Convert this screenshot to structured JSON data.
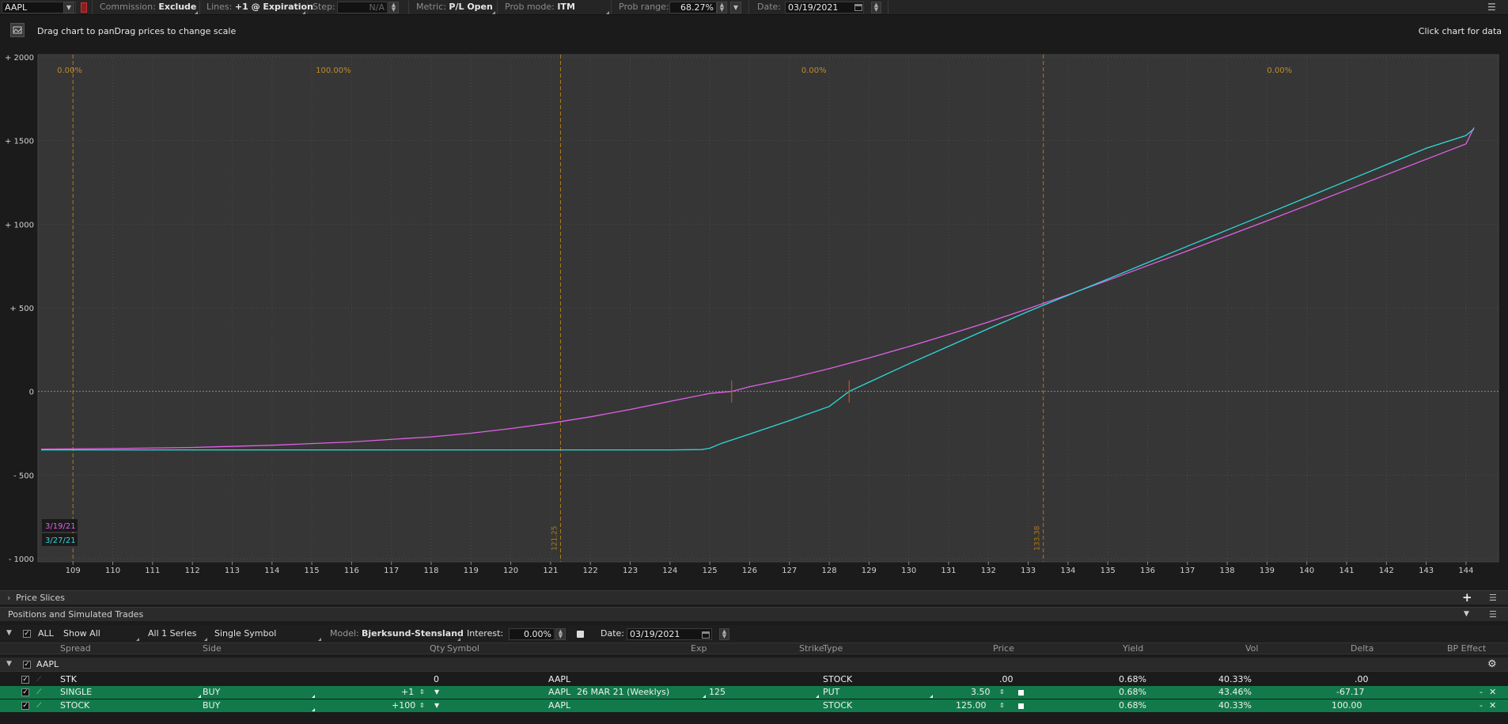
{
  "toolbar": {
    "symbol": "AAPL",
    "commission_label": "Commission:",
    "commission_value": "Exclude",
    "lines_label": "Lines:",
    "lines_value": "+1 @ Expiration",
    "step_label": "Step:",
    "step_value": "N/A",
    "metric_label": "Metric:",
    "metric_value": "P/L Open",
    "probmode_label": "Prob mode:",
    "probmode_value": "ITM",
    "probrange_label": "Prob range:",
    "probrange_value": "68.27%",
    "date_label": "Date:",
    "date_value": "03/19/2021"
  },
  "info": {
    "drag_hint": "Drag chart to panDrag prices to change scale",
    "click_hint": "Click chart for data"
  },
  "chart_data": {
    "type": "line",
    "x_ticks": [
      109,
      110,
      111,
      112,
      113,
      114,
      115,
      116,
      117,
      118,
      119,
      120,
      121,
      122,
      123,
      124,
      125,
      126,
      127,
      128,
      129,
      130,
      131,
      132,
      133,
      134,
      135,
      136,
      137,
      138,
      139,
      140,
      141,
      142,
      143,
      144
    ],
    "y_ticks": [
      {
        "value": 2000,
        "label": "+ 2000"
      },
      {
        "value": 1500,
        "label": "+ 1500"
      },
      {
        "value": 1000,
        "label": "+ 1000"
      },
      {
        "value": 500,
        "label": "+ 500"
      },
      {
        "value": 0,
        "label": "0"
      },
      {
        "value": -500,
        "label": "- 500"
      },
      {
        "value": -1000,
        "label": "- 1000"
      }
    ],
    "xlim": [
      108.1,
      144.5
    ],
    "ylim": [
      -1000,
      2000
    ],
    "prob_lines": [
      {
        "x": 109,
        "label": ""
      },
      {
        "x": 121.25,
        "label": "121.25"
      },
      {
        "x": 133.38,
        "label": "133.38"
      }
    ],
    "prob_zones": [
      {
        "x": 108.6,
        "text": "0.00%"
      },
      {
        "x": 115.1,
        "text": "100.00%"
      },
      {
        "x": 127.3,
        "text": "0.00%"
      },
      {
        "x": 139.0,
        "text": "0.00%"
      }
    ],
    "breakeven_marks": [
      {
        "x": 125.55,
        "y": 0
      },
      {
        "x": 128.5,
        "y": 0
      }
    ],
    "series": [
      {
        "name": "3/19/21",
        "color": "#e060e8",
        "points": [
          [
            108.2,
            -345
          ],
          [
            110,
            -342
          ],
          [
            112,
            -335
          ],
          [
            114,
            -322
          ],
          [
            116,
            -302
          ],
          [
            118,
            -272
          ],
          [
            119,
            -250
          ],
          [
            120,
            -222
          ],
          [
            121,
            -190
          ],
          [
            122,
            -152
          ],
          [
            123,
            -108
          ],
          [
            124,
            -60
          ],
          [
            125,
            -12
          ],
          [
            125.55,
            0
          ],
          [
            126,
            28
          ],
          [
            127,
            78
          ],
          [
            128,
            136
          ],
          [
            129,
            200
          ],
          [
            130,
            268
          ],
          [
            131,
            340
          ],
          [
            132,
            415
          ],
          [
            133,
            495
          ],
          [
            134,
            578
          ],
          [
            135,
            664
          ],
          [
            136,
            752
          ],
          [
            137,
            840
          ],
          [
            138,
            930
          ],
          [
            139,
            1020
          ],
          [
            140,
            1112
          ],
          [
            141,
            1204
          ],
          [
            142,
            1296
          ],
          [
            143,
            1388
          ],
          [
            144,
            1480
          ],
          [
            144.2,
            1578
          ]
        ]
      },
      {
        "name": "3/27/21",
        "color": "#30d8d8",
        "points": [
          [
            108.2,
            -350
          ],
          [
            110,
            -350
          ],
          [
            112,
            -350
          ],
          [
            114,
            -350
          ],
          [
            116,
            -350
          ],
          [
            118,
            -350
          ],
          [
            120,
            -350
          ],
          [
            122,
            -350
          ],
          [
            124,
            -350
          ],
          [
            124.8,
            -348
          ],
          [
            125,
            -340
          ],
          [
            125.3,
            -310
          ],
          [
            126,
            -255
          ],
          [
            127,
            -175
          ],
          [
            128,
            -90
          ],
          [
            128.5,
            0
          ],
          [
            129,
            55
          ],
          [
            130,
            165
          ],
          [
            131,
            270
          ],
          [
            132,
            375
          ],
          [
            133,
            478
          ],
          [
            134,
            575
          ],
          [
            135,
            672
          ],
          [
            136,
            770
          ],
          [
            137,
            868
          ],
          [
            138,
            965
          ],
          [
            139,
            1062
          ],
          [
            140,
            1160
          ],
          [
            141,
            1258
          ],
          [
            142,
            1356
          ],
          [
            143,
            1454
          ],
          [
            144,
            1530
          ],
          [
            144.2,
            1570
          ]
        ]
      }
    ]
  },
  "sections": {
    "price_slices": "Price Slices",
    "positions": "Positions and Simulated Trades"
  },
  "filters": {
    "all": "ALL",
    "show": "Show All",
    "series": "All 1 Series",
    "symbol_mode": "Single Symbol",
    "model_label": "Model:",
    "model_value": "Bjerksund-Stensland",
    "interest_label": "Interest:",
    "interest_value": "0.00%",
    "date_label": "Date:",
    "date_value": "03/19/2021"
  },
  "table": {
    "columns": [
      "Spread",
      "Side",
      "Qty",
      "Symbol",
      "Exp",
      "Strike",
      "Type",
      "Price",
      "Yield",
      "Vol",
      "Delta",
      "BP Effect"
    ],
    "group": "AAPL",
    "rows": [
      {
        "spread": "STK",
        "side": "",
        "qty": "0",
        "symbol": "AAPL",
        "exp": "",
        "strike": "",
        "type": "STOCK",
        "price": ".00",
        "yield": "0.68%",
        "vol": "40.33%",
        "delta": ".00",
        "bp": "",
        "highlight": false
      },
      {
        "spread": "SINGLE",
        "side": "BUY",
        "qty": "+1",
        "symbol": "AAPL",
        "exp": "26 MAR 21 (Weeklys)",
        "strike": "125",
        "type": "PUT",
        "price": "3.50",
        "yield": "0.68%",
        "vol": "43.46%",
        "delta": "-67.17",
        "bp": "-",
        "highlight": true
      },
      {
        "spread": "STOCK",
        "side": "BUY",
        "qty": "+100",
        "symbol": "AAPL",
        "exp": "",
        "strike": "",
        "type": "STOCK",
        "price": "125.00",
        "yield": "0.68%",
        "vol": "40.33%",
        "delta": "100.00",
        "bp": "-",
        "highlight": true
      }
    ]
  }
}
